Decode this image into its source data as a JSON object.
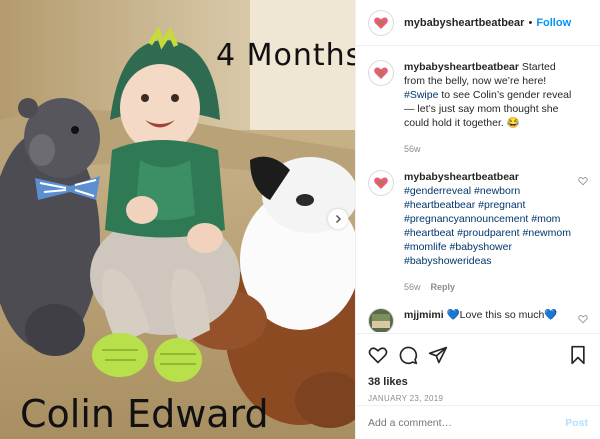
{
  "post": {
    "photo": {
      "overlay_top": "4 Months",
      "overlay_bottom": "Colin Edward"
    },
    "header": {
      "username": "mybabysheartbeatbear",
      "separator": "•",
      "follow_label": "Follow"
    },
    "caption": {
      "username": "mybabysheartbeatbear",
      "text_before": " Started from the belly, now we’re here! ",
      "tag": "#Swipe",
      "text_after": " to see Colin’s gender reveal— let’s just say mom thought she could hold it together. 😂",
      "time": "56w"
    },
    "hashtag_comment": {
      "username": "mybabysheartbeatbear",
      "tags": "#genderreveal #newborn #heartbeatbear #pregnant #pregnancyannouncement #mom #heartbeat #proudparent #newmom #momlife #babyshower #babyshowerideas",
      "time": "56w",
      "reply_label": "Reply"
    },
    "fan_comment": {
      "username": "mjjmimi",
      "text": " 💙Love this so much💙"
    },
    "likes": "38 likes",
    "date": "JANUARY 23, 2019",
    "add_comment": {
      "placeholder": "Add a comment…",
      "post_label": "Post"
    },
    "icons": {
      "like": "heart-icon",
      "comment": "comment-icon",
      "share": "share-icon",
      "save": "bookmark-icon",
      "next": "chevron-right-icon"
    },
    "colors": {
      "link": "#0095f6",
      "hashtag": "#00376b",
      "muted": "#8e8e8e",
      "post_disabled": "#b2dffc"
    }
  }
}
